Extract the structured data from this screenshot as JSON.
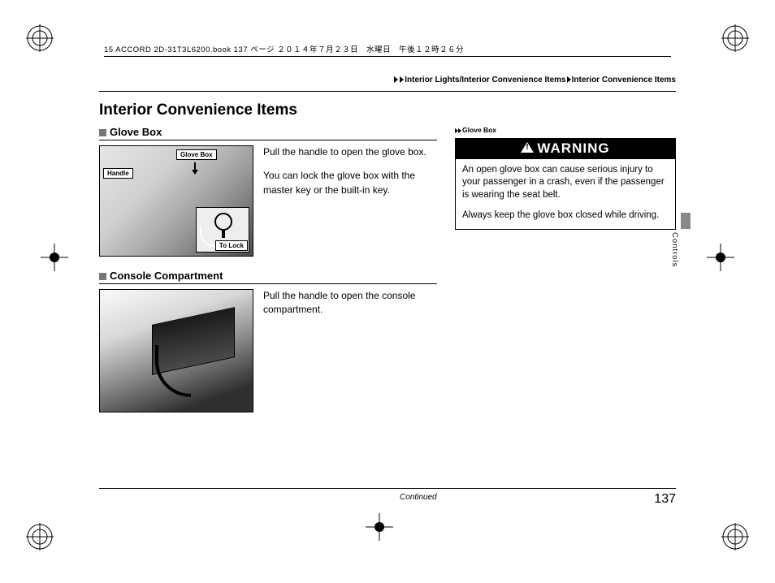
{
  "source_line": "15 ACCORD 2D-31T3L6200.book  137 ページ  ２０１４年７月２３日　水曜日　午後１２時２６分",
  "breadcrumb": {
    "a": "Interior Lights/Interior Convenience Items",
    "b": "Interior Convenience Items"
  },
  "page_title": "Interior Convenience Items",
  "sections": {
    "glove": {
      "heading": "Glove Box",
      "p1": "Pull the handle to open the glove box.",
      "p2": "You can lock the glove box with the master key or the built-in key.",
      "callout_box": "Glove Box",
      "callout_handle": "Handle",
      "callout_lock": "To Lock"
    },
    "console": {
      "heading": "Console Compartment",
      "p1": "Pull the handle to open the console compartment."
    }
  },
  "sidebar": {
    "ref": "Glove Box",
    "warning_label": "WARNING",
    "warning_p1": "An open glove box can cause serious injury to your passenger in a crash, even if the passenger is wearing the seat belt.",
    "warning_p2": "Always keep the glove box closed while driving."
  },
  "tab_label": "Controls",
  "continued": "Continued",
  "page_number": "137"
}
